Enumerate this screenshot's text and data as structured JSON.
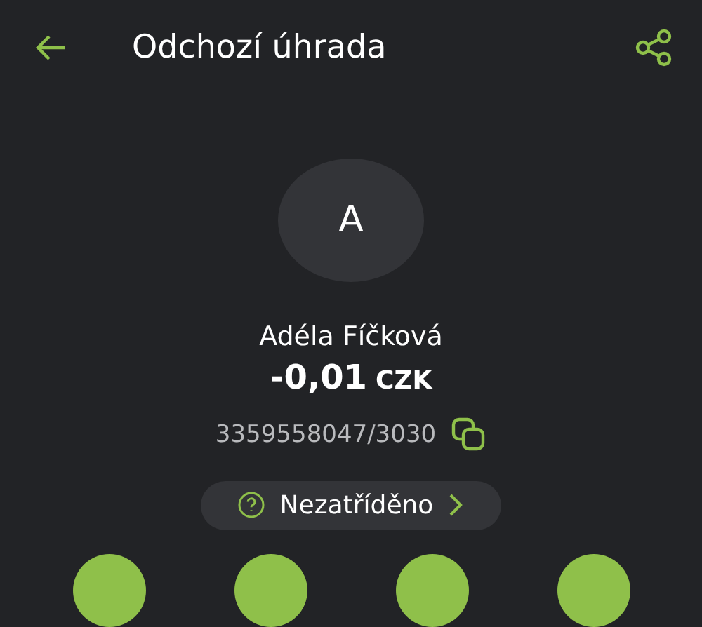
{
  "header": {
    "title": "Odchozí úhrada"
  },
  "counterparty": {
    "initial": "A",
    "name": "Adéla Fíčková",
    "amount": "-0,01",
    "currency": "CZK",
    "account": "3359558047/3030"
  },
  "category": {
    "label": "Nezatříděno"
  },
  "actions": [
    {
      "kind": "action"
    },
    {
      "kind": "action"
    },
    {
      "kind": "action"
    },
    {
      "kind": "action"
    }
  ]
}
